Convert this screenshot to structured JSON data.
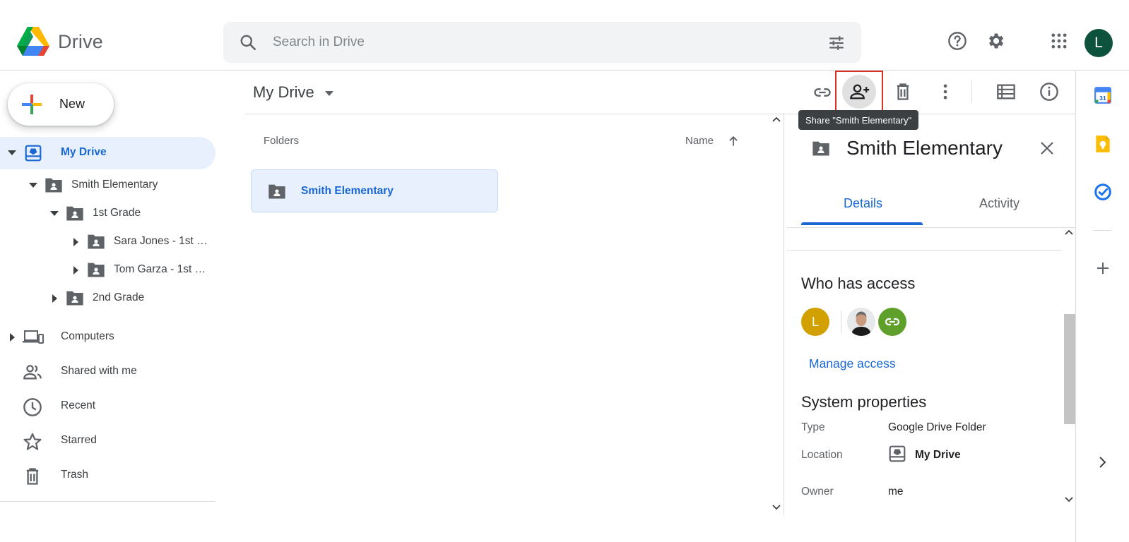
{
  "header": {
    "app_name": "Drive",
    "search_placeholder": "Search in Drive",
    "avatar_initial": "L",
    "icons": [
      "drive-logo",
      "search-icon",
      "tune-icon",
      "help-icon",
      "settings-icon",
      "apps-icon"
    ]
  },
  "sidebar": {
    "new_label": "New",
    "items": [
      {
        "label": "My Drive",
        "active": true
      },
      {
        "label": "Smith Elementary"
      },
      {
        "label": "1st Grade"
      },
      {
        "label": "Sara Jones - 1st Grade"
      },
      {
        "label": "Tom Garza - 1st Grade"
      },
      {
        "label": "2nd Grade"
      },
      {
        "label": "Computers"
      },
      {
        "label": "Shared with me"
      },
      {
        "label": "Recent"
      },
      {
        "label": "Starred"
      },
      {
        "label": "Trash"
      }
    ]
  },
  "main": {
    "title": "My Drive",
    "folders_label": "Folders",
    "sort_label": "Name",
    "folder_card": "Smith Elementary"
  },
  "toolbar": {
    "tooltip": "Share \"Smith Elementary\"",
    "icons": [
      "link-icon",
      "share-icon",
      "trash-icon",
      "more-vert-icon",
      "list-view-icon",
      "info-icon"
    ]
  },
  "details": {
    "title": "Smith Elementary",
    "tab_details": "Details",
    "tab_activity": "Activity",
    "who_has_access": "Who has access",
    "access_avatar_initial": "L",
    "manage_access": "Manage access",
    "system_properties": "System properties",
    "props": [
      {
        "key": "Type",
        "value": "Google Drive Folder"
      },
      {
        "key": "Location",
        "value": "My Drive"
      },
      {
        "key": "Owner",
        "value": "me"
      }
    ]
  },
  "colors": {
    "accent": "#1967d2",
    "active_bg": "#e8f0fe",
    "highlight": "#d93025",
    "avatar_header": "#0d523c",
    "avatar_access": "#d2a000",
    "link_avatar": "#5fa02a"
  }
}
